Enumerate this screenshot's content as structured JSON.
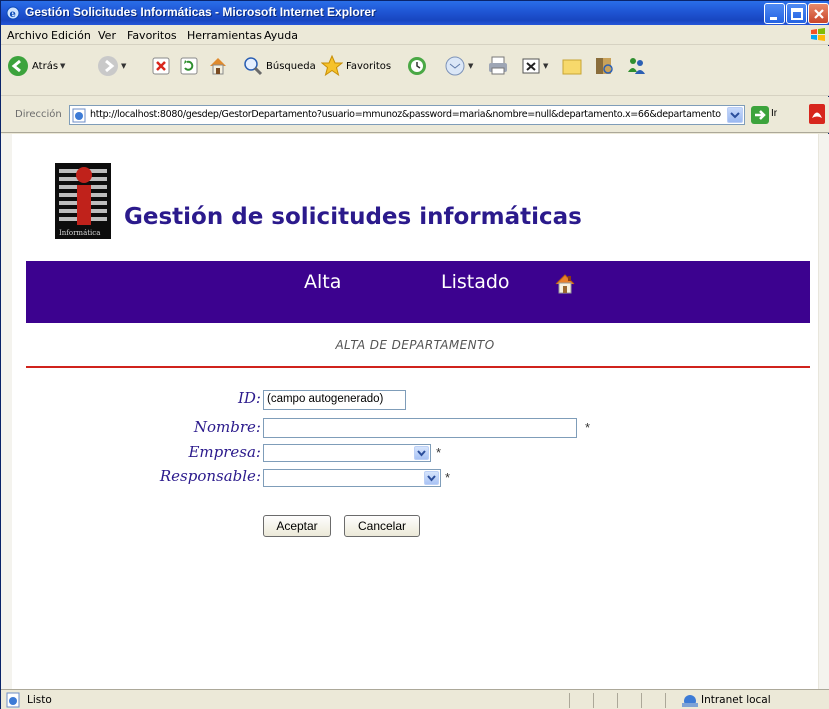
{
  "window": {
    "title": "Gestión Solicitudes Informáticas - Microsoft Internet Explorer"
  },
  "menu": {
    "items": [
      "Archivo",
      "Edición",
      "Ver",
      "Favoritos",
      "Herramientas",
      "Ayuda"
    ]
  },
  "toolbar": {
    "back_label": "Atrás",
    "search_label": "Búsqueda",
    "favorites_label": "Favoritos"
  },
  "address": {
    "label": "Dirección",
    "url": "http://localhost:8080/gesdep/GestorDepartamento?usuario=mmunoz&password=maria&nombre=null&departamento.x=66&departamento",
    "go_label": "Ir"
  },
  "page": {
    "logo_text": "Informática",
    "app_title": "Gestión de solicitudes informáticas",
    "nav": {
      "alta": "Alta",
      "listado": "Listado"
    },
    "section_title": "ALTA DE DEPARTAMENTO",
    "form": {
      "id_label": "ID:",
      "id_value": "(campo autogenerado)",
      "nombre_label": "Nombre:",
      "nombre_value": "",
      "empresa_label": "Empresa:",
      "empresa_value": "",
      "responsable_label": "Responsable:",
      "responsable_value": "",
      "required_mark": "*",
      "accept_label": "Aceptar",
      "cancel_label": "Cancelar"
    },
    "colors": {
      "brand": "#3c028f",
      "title": "#2b1a8c",
      "divider": "#d0231c"
    }
  },
  "status": {
    "text": "Listo",
    "zone": "Intranet local"
  }
}
